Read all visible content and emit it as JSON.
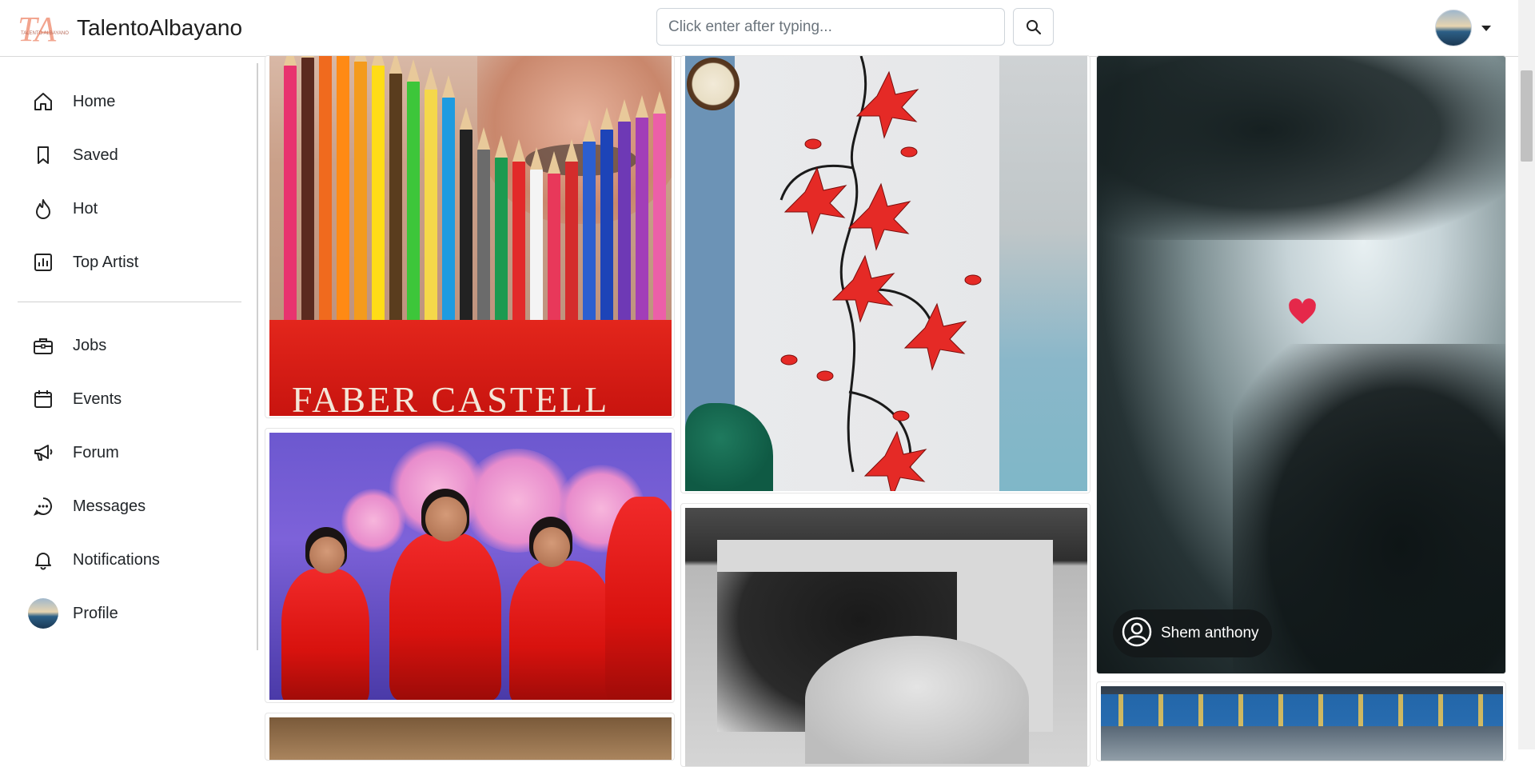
{
  "app": {
    "brand_name": "TalentoAlbayano",
    "logo_letters": "TA",
    "logo_caption": "TALENTO ALBAYANO"
  },
  "search": {
    "placeholder": "Click enter after typing...",
    "button_icon": "search-icon"
  },
  "user_menu": {
    "avatar_icon": "user-avatar",
    "caret_icon": "caret-down-icon"
  },
  "sidebar": {
    "primary": [
      {
        "label": "Home",
        "icon": "home-icon"
      },
      {
        "label": "Saved",
        "icon": "bookmark-icon"
      },
      {
        "label": "Hot",
        "icon": "flame-icon"
      },
      {
        "label": "Top Artist",
        "icon": "bar-chart-icon"
      }
    ],
    "secondary": [
      {
        "label": "Jobs",
        "icon": "briefcase-icon"
      },
      {
        "label": "Events",
        "icon": "calendar-icon"
      },
      {
        "label": "Forum",
        "icon": "megaphone-icon"
      },
      {
        "label": "Messages",
        "icon": "chat-dots-icon"
      },
      {
        "label": "Notifications",
        "icon": "bell-icon"
      },
      {
        "label": "Profile",
        "icon": "profile-avatar"
      }
    ]
  },
  "feed": {
    "posts": [
      {
        "id": "pencils",
        "overlay_text": "FABER CASTELL"
      },
      {
        "id": "dancers"
      },
      {
        "id": "wall-flowers"
      },
      {
        "id": "charcoal-drawing"
      },
      {
        "id": "blurred-portrait",
        "author": "Shem anthony",
        "like_icon": "heart-icon",
        "author_icon": "user-circle-icon"
      },
      {
        "id": "stadium"
      }
    ]
  },
  "colors": {
    "accent_logo": "#f0a08c",
    "heart": "#e5284a",
    "chip_bg": "#14181a"
  }
}
